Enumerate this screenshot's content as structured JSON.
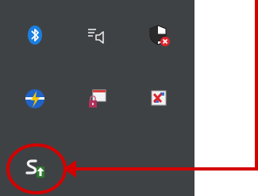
{
  "tray": {
    "background": "#3f4245",
    "icons": [
      {
        "name": "bluetooth-icon"
      },
      {
        "name": "volume-muted-icon"
      },
      {
        "name": "security-shield-alert-icon"
      },
      {
        "name": "power-plan-icon"
      },
      {
        "name": "locked-window-icon"
      },
      {
        "name": "network-disconnected-icon"
      },
      {
        "name": "sync-upload-icon"
      }
    ]
  },
  "annotation": {
    "color": "#d40000",
    "target": "sync-upload-icon"
  }
}
